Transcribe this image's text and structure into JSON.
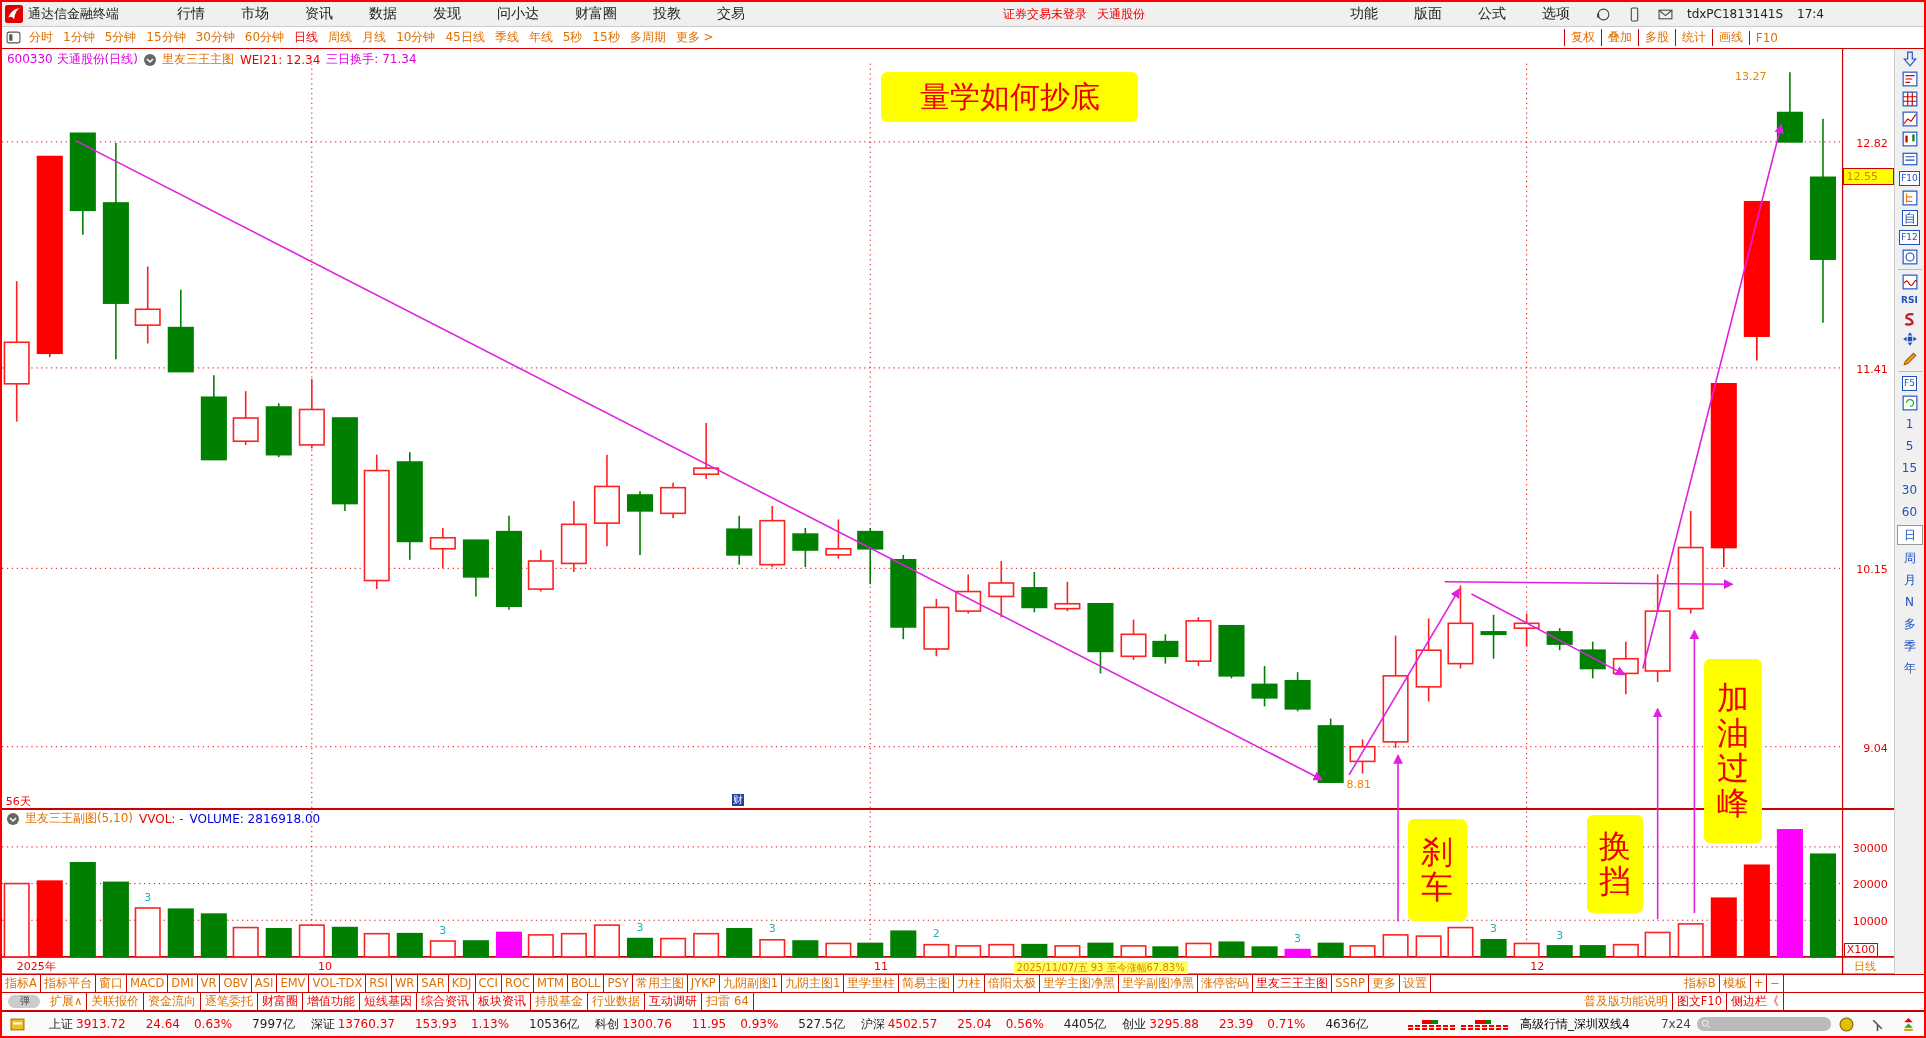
{
  "menubar": {
    "app_title": "通达信金融终端",
    "menus": [
      "行情",
      "市场",
      "资讯",
      "数据",
      "发现",
      "问小达",
      "财富圈",
      "投教",
      "交易"
    ],
    "notice": "证券交易未登录",
    "notice_stock": "天通股份",
    "right_menus": [
      "功能",
      "版面",
      "公式",
      "选项"
    ],
    "user": "tdxPC1813141S",
    "time": "17:4"
  },
  "periods": [
    {
      "label": "分时",
      "selected": false
    },
    {
      "label": "1分钟",
      "selected": false
    },
    {
      "label": "5分钟",
      "selected": false
    },
    {
      "label": "15分钟",
      "selected": false
    },
    {
      "label": "30分钟",
      "selected": false
    },
    {
      "label": "60分钟",
      "selected": false
    },
    {
      "label": "日线",
      "selected": true
    },
    {
      "label": "周线",
      "selected": false
    },
    {
      "label": "月线",
      "selected": false
    },
    {
      "label": "10分钟",
      "selected": false
    },
    {
      "label": "45日线",
      "selected": false
    },
    {
      "label": "季线",
      "selected": false
    },
    {
      "label": "年线",
      "selected": false
    },
    {
      "label": "5秒",
      "selected": false
    },
    {
      "label": "15秒",
      "selected": false
    },
    {
      "label": "多周期",
      "selected": false
    },
    {
      "label": "更多 >",
      "selected": false
    }
  ],
  "chart_tools": [
    "复权",
    "叠加",
    "多股",
    "统计",
    "画线",
    "F10"
  ],
  "info_line": {
    "symbol": "600330 天通股份(日线)",
    "indicator": "里友三王主图",
    "wei": "WEI21: 12.34",
    "turnover": "三日换手: 71.34"
  },
  "price_axis": [
    "12.82",
    "11.41",
    "10.15",
    "9.04"
  ],
  "current_price": "12.55",
  "high_label": "13.27",
  "low_label": "8.81",
  "annotations": [
    {
      "text": "量学如何抄底",
      "kind": "horizontal"
    },
    {
      "text": "刹车",
      "kind": "vertical"
    },
    {
      "text": "换挡",
      "kind": "vertical"
    },
    {
      "text": "加油过峰",
      "kind": "vertical"
    }
  ],
  "days_label": "56天",
  "finance_marker": "财",
  "volume_panel": {
    "indicator": "里友三王副图(5,10)",
    "vvol": "VVOL: -",
    "volume": "VOLUME: 2816918.00",
    "axis": [
      "30000",
      "20000",
      "10000"
    ],
    "scale": "X100",
    "marks": [
      "3",
      "3",
      "3",
      "3",
      "2",
      "3",
      "3",
      "3"
    ]
  },
  "date_axis": [
    "2025年",
    "10",
    "11",
    "12"
  ],
  "date_tooltip": "2025/11/07/五 93 至今涨幅67.83%",
  "period_label": "日线",
  "sidebar": {
    "tools": [
      "F10",
      "自",
      "F12",
      "RSI",
      "F5"
    ],
    "items": [
      {
        "label": "1",
        "selected": false
      },
      {
        "label": "5",
        "selected": false
      },
      {
        "label": "15",
        "selected": false
      },
      {
        "label": "30",
        "selected": false
      },
      {
        "label": "60",
        "selected": false
      },
      {
        "label": "日",
        "selected": true
      },
      {
        "label": "周",
        "selected": false
      },
      {
        "label": "月",
        "selected": false
      },
      {
        "label": "N",
        "selected": false
      },
      {
        "label": "多",
        "selected": false
      },
      {
        "label": "季",
        "selected": false
      },
      {
        "label": "年",
        "selected": false
      }
    ]
  },
  "indicator_tabs": [
    {
      "label": "指标A",
      "selected": false
    },
    {
      "label": "指标平台",
      "selected": false
    },
    {
      "label": "窗口",
      "selected": false
    },
    {
      "label": "MACD",
      "selected": false
    },
    {
      "label": "DMI",
      "selected": false
    },
    {
      "label": "VR",
      "selected": false
    },
    {
      "label": "OBV",
      "selected": false
    },
    {
      "label": "ASI",
      "selected": false
    },
    {
      "label": "EMV",
      "selected": false
    },
    {
      "label": "VOL-TDX",
      "selected": false
    },
    {
      "label": "RSI",
      "selected": false
    },
    {
      "label": "WR",
      "selected": false
    },
    {
      "label": "SAR",
      "selected": false
    },
    {
      "label": "KDJ",
      "selected": false
    },
    {
      "label": "CCI",
      "selected": false
    },
    {
      "label": "ROC",
      "selected": false
    },
    {
      "label": "MTM",
      "selected": false
    },
    {
      "label": "BOLL",
      "selected": false
    },
    {
      "label": "PSY",
      "selected": false
    },
    {
      "label": "常用主图",
      "selected": false
    },
    {
      "label": "JYKP",
      "selected": false
    },
    {
      "label": "九阴副图1",
      "selected": false
    },
    {
      "label": "九阴主图1",
      "selected": false
    },
    {
      "label": "里学里柱",
      "selected": false
    },
    {
      "label": "简易主图",
      "selected": false
    },
    {
      "label": "力柱",
      "selected": false
    },
    {
      "label": "倍阳太极",
      "selected": false
    },
    {
      "label": "里学主图净黑",
      "selected": false
    },
    {
      "label": "里学副图净黑",
      "selected": false
    },
    {
      "label": "涨停密码",
      "selected": false
    },
    {
      "label": "里友三王主图",
      "selected": true
    },
    {
      "label": "SSRP",
      "selected": false
    },
    {
      "label": "更多",
      "selected": false
    },
    {
      "label": "设置",
      "selected": false
    }
  ],
  "indicator_tabs_right": [
    "指标B",
    "模板",
    "+",
    "−"
  ],
  "toggle_label": "弹",
  "toggle_on": false,
  "feature_tabs": [
    {
      "label": "扩展∧",
      "kind": "normal"
    },
    {
      "label": "关联报价",
      "kind": "normal"
    },
    {
      "label": "资金流向",
      "kind": "normal"
    },
    {
      "label": "逐笔委托",
      "kind": "normal"
    },
    {
      "label": "财富圈",
      "kind": "hot"
    },
    {
      "label": "增值功能",
      "kind": "hot"
    },
    {
      "label": "短线基因",
      "kind": "hot"
    },
    {
      "label": "综合资讯",
      "kind": "hot"
    },
    {
      "label": "板块资讯",
      "kind": "hot"
    },
    {
      "label": "持股基金",
      "kind": "normal"
    },
    {
      "label": "行业数据",
      "kind": "normal"
    },
    {
      "label": "互动调研",
      "kind": "hot"
    },
    {
      "label": "扫雷 64",
      "kind": "normal"
    }
  ],
  "feature_tabs_right": [
    {
      "label": "普及版功能说明",
      "kind": "normal"
    },
    {
      "label": "图文F10",
      "kind": "hot"
    },
    {
      "label": "侧边栏《",
      "kind": "hot"
    }
  ],
  "indices": [
    {
      "name": "上证",
      "value": "3913.72",
      "change": "24.64",
      "percent": "0.63%",
      "amount": "7997亿"
    },
    {
      "name": "深证",
      "value": "13760.37",
      "change": "153.93",
      "percent": "1.13%",
      "amount": "10536亿"
    },
    {
      "name": "科创",
      "value": "1300.76",
      "change": "11.95",
      "percent": "0.93%",
      "amount": "527.5亿"
    },
    {
      "name": "沪深",
      "value": "4502.57",
      "change": "25.04",
      "percent": "0.56%",
      "amount": "4405亿"
    },
    {
      "name": "创业",
      "value": "3295.88",
      "change": "23.39",
      "percent": "0.71%",
      "amount": "4636亿"
    }
  ],
  "market_source": "高级行情_深圳双线4",
  "session": "7x24"
}
